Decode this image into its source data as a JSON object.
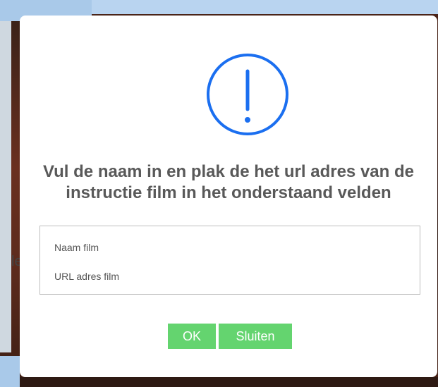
{
  "dialog": {
    "icon": "exclamation-circle-icon",
    "title": "Vul de naam in en plak de het url adres van de instructie film in het onderstaand velden",
    "fields": {
      "name_placeholder": "Naam film",
      "name_value": "",
      "url_placeholder": "URL adres film",
      "url_value": ""
    },
    "buttons": {
      "ok_label": "OK",
      "close_label": "Sluiten"
    }
  },
  "background": {
    "partial_text": "le"
  },
  "colors": {
    "icon_blue": "#1b6ff0",
    "button_green": "#64d46f",
    "title_gray": "#595959"
  }
}
